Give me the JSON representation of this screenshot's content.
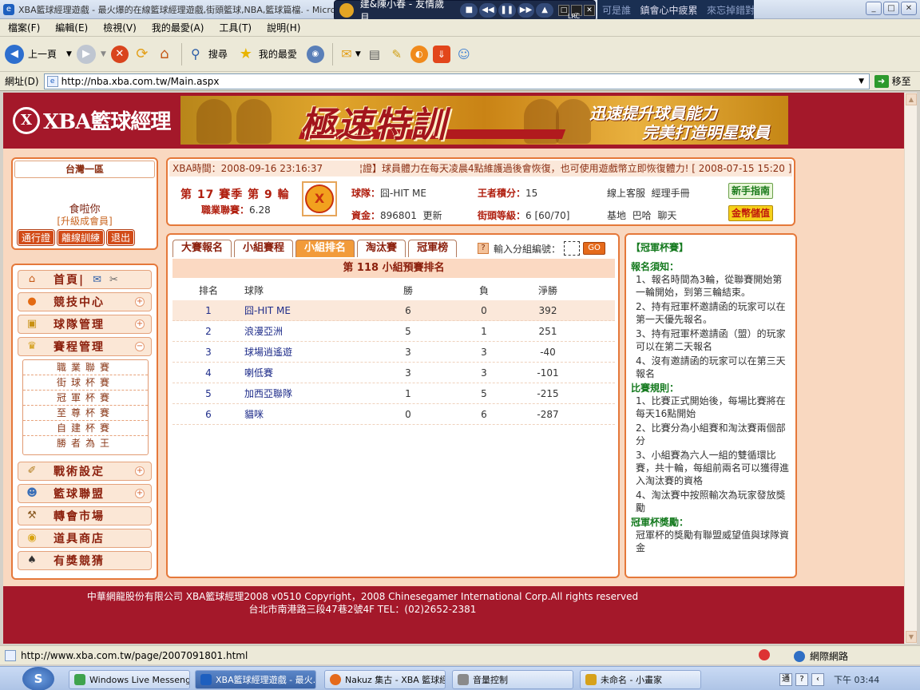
{
  "window": {
    "title": "XBA籃球經理遊戲 - 最火爆的在線籃球經理遊戲,街頭籃球,NBA,籃球篇檔. - Microsoft Inte",
    "ie_glyph": "e"
  },
  "media_player": {
    "track": "建&陳小春 - 友情歲月",
    "lrc_label": "LRC",
    "marquee_text": "可是誰",
    "marquee_text2": "鎮會心中疲累",
    "marquee_text3": "來忘掉錯對"
  },
  "menubar": [
    "檔案(F)",
    "編輯(E)",
    "檢視(V)",
    "我的最愛(A)",
    "工具(T)",
    "說明(H)"
  ],
  "toolbar": {
    "back_label": "上一頁",
    "search_label": "搜尋",
    "favorites_label": "我的最愛"
  },
  "addressbar": {
    "label": "網址(D)",
    "url": "http://nba.xba.com.tw/Main.aspx",
    "go_label": "移至"
  },
  "site": {
    "logo_mark": "X",
    "logo_text": "XBA籃球經理",
    "banner_title": "極速特訓",
    "banner_sub1": "迅速提升球員能力",
    "banner_sub2": "完美打造明星球員"
  },
  "user": {
    "server": "台灣一區",
    "name": "食啦你",
    "membership": "[升級成會員]",
    "buttons": [
      "通行證",
      "離線訓練",
      "退出"
    ]
  },
  "leftmenu": {
    "items": [
      {
        "label": "首頁|",
        "icon": "home-icon"
      },
      {
        "label": "競技中心",
        "icon": "basketball-icon"
      },
      {
        "label": "球隊管理",
        "icon": "jersey-icon"
      },
      {
        "label": "賽程管理",
        "icon": "trophy-icon"
      },
      {
        "label": "戰術設定",
        "icon": "tactics-icon"
      },
      {
        "label": "籃球聯盟",
        "icon": "people-icon"
      },
      {
        "label": "轉會市場",
        "icon": "hammer-icon"
      },
      {
        "label": "道具商店",
        "icon": "coins-icon"
      },
      {
        "label": "有獎競猜",
        "icon": "spade-icon"
      }
    ],
    "submenu": [
      "職業聯賽",
      "街球杯賽",
      "冠軍杯賽",
      "至尊杯賽",
      "自建杯賽",
      "勝者為王"
    ],
    "plus": "+",
    "minus": "−"
  },
  "info": {
    "time_label": "XBA時間：",
    "time_value": "2008-09-16 23:16:37",
    "notice": "¦證】球員體力在每天凌晨4點維護過後會恢復，也可使用遊戲幣立即恢復體力! [ 2008-07-15 15:20 ]",
    "season_prefix": "第",
    "season_num": "17",
    "season_mid": "賽季 第",
    "round_num": "9",
    "round_suffix": "輪",
    "league_label": "職業聯賽：",
    "league_value": "6.28",
    "team_label": "球隊：",
    "team_value": "囧-HIT ME",
    "funds_label": "資金：",
    "funds_value": "896801",
    "update_link": "更新",
    "king_label": "王者積分：",
    "king_value": "15",
    "level_label": "街頭等級：",
    "level_value": "6 [60/70]",
    "service": "線上客服",
    "manual": "經理手冊",
    "base": "基地",
    "bar": "巴哈",
    "chat": "聊天",
    "newbie_btn": "新手指南",
    "gold_btn": "金幣儲值"
  },
  "tabs": [
    "大賽報名",
    "小組賽程",
    "小組排名",
    "淘汰賽",
    "冠軍榜"
  ],
  "group_input": {
    "help": "?",
    "label": "輸入分組編號：",
    "go": "GO"
  },
  "ranking": {
    "title": "第 118 小組預賽排名",
    "columns": [
      "排名",
      "球隊",
      "勝",
      "負",
      "淨勝"
    ],
    "rows": [
      {
        "rank": "1",
        "team": "囧-HIT ME",
        "w": "6",
        "l": "0",
        "net": "392"
      },
      {
        "rank": "2",
        "team": "浪漫亞洲",
        "w": "5",
        "l": "1",
        "net": "251"
      },
      {
        "rank": "3",
        "team": "球場逍遙遊",
        "w": "3",
        "l": "3",
        "net": "-40"
      },
      {
        "rank": "4",
        "team": "喇低賽",
        "w": "3",
        "l": "3",
        "net": "-101"
      },
      {
        "rank": "5",
        "team": "加西亞聯隊",
        "w": "1",
        "l": "5",
        "net": "-215"
      },
      {
        "rank": "6",
        "team": "貓咪",
        "w": "0",
        "l": "6",
        "net": "-287"
      }
    ]
  },
  "cup": {
    "title": "【冠軍杯賽】",
    "reg_title": "報名須知：",
    "reg": [
      "1、報名時間為3輪，從聯賽開始第一輪開始，到第三輪結束。",
      "2、持有冠軍杯邀請函的玩家可以在第一天優先報名。",
      "3、持有冠軍杯邀請函（盟）的玩家可以在第二天報名",
      "4、沒有邀請函的玩家可以在第三天報名"
    ],
    "rule_title": "比賽規則：",
    "rules": [
      "1、比賽正式開始後，每場比賽將在每天16點開始",
      "2、比賽分為小組賽和淘汰賽兩個部分",
      "3、小組賽為六人一組的雙循環比賽，共十輪，每組前兩名可以獲得進入淘汰賽的資格",
      "4、淘汰賽中按照輸次為玩家發放獎勵"
    ],
    "reward_title": "冠軍杯獎勵：",
    "reward": "冠軍杯的獎勵有聯盟威望值與球隊資金"
  },
  "footer": {
    "line1": "中華網龍股份有限公司  XBA籃球經理2008 v0510     Copyright，2008 Chinesegamer International Corp.All rights reserved",
    "line2": "台北市南港路三段47巷2號4F TEL：(02)2652-2381"
  },
  "statusbar": {
    "url": "http://www.xba.com.tw/page/2007091801.html",
    "zone": "網際網路"
  },
  "taskbar": {
    "start": "S",
    "tasks": [
      "Windows Live Messenger",
      "XBA籃球經理遊戲 - 最火...",
      "Nakuz 集古 - XBA 籃球經...",
      "音量控制",
      "未命名 - 小畫家"
    ],
    "tray_ime": "通",
    "tray_help": "?",
    "clock": "下午 03:44"
  },
  "colors": {
    "brand_red": "#a4182a",
    "accent_orange": "#e5783a",
    "page_bg": "#f9d8c0",
    "tab_active": "#f29b3a"
  }
}
